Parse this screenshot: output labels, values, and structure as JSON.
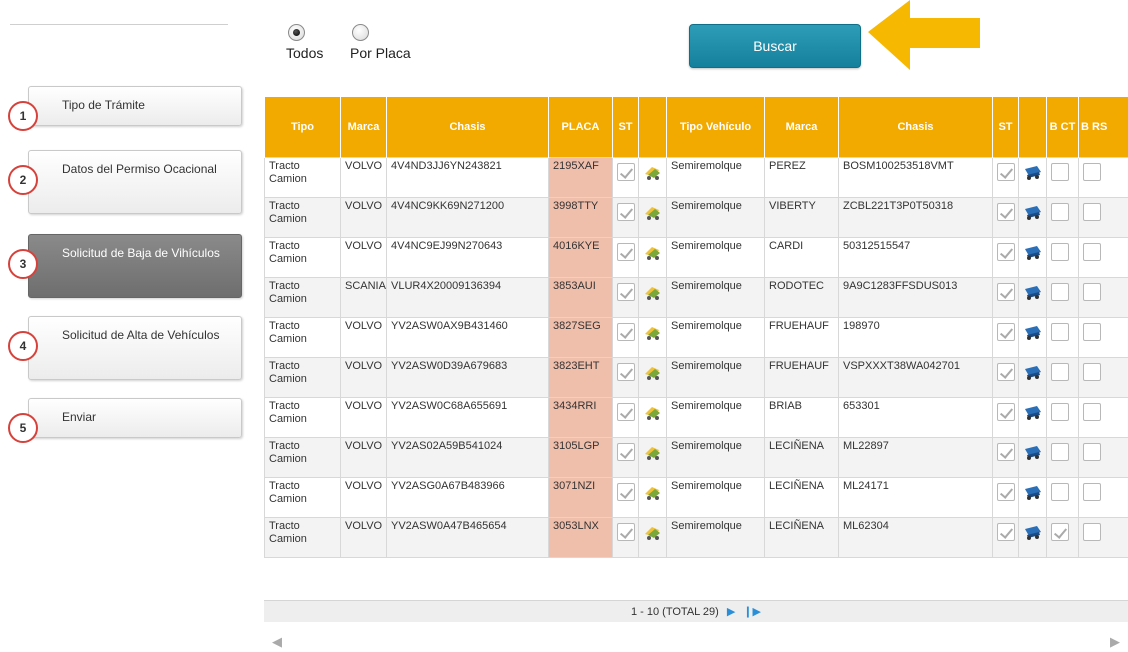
{
  "filter": {
    "options": [
      {
        "label": "Todos",
        "selected": true
      },
      {
        "label": "Por Placa",
        "selected": false
      }
    ]
  },
  "search_button": "Buscar",
  "steps": [
    {
      "num": "1",
      "label": "Tipo de Trámite"
    },
    {
      "num": "2",
      "label": "Datos del Permiso Ocacional"
    },
    {
      "num": "3",
      "label": "Solicitud de Baja de Vihículos",
      "active": true
    },
    {
      "num": "4",
      "label": "Solicitud de Alta de Vehículos"
    },
    {
      "num": "5",
      "label": "Enviar"
    }
  ],
  "table": {
    "headers": [
      "Tipo",
      "Marca",
      "Chasis",
      "PLACA",
      "ST",
      "",
      "Tipo Vehículo",
      "Marca",
      "Chasis",
      "ST",
      "",
      "B CT",
      "B RS"
    ],
    "rows": [
      {
        "tipo": "Tracto Camion",
        "marca": "VOLVO",
        "chasis": "4V4ND3JJ6YN243821",
        "placa": "2195XAF",
        "tipo2": "Semiremolque",
        "marca2": "PEREZ",
        "chasis2": "BOSM100253518VMT",
        "bct": false
      },
      {
        "tipo": "Tracto Camion",
        "marca": "VOLVO",
        "chasis": "4V4NC9KK69N271200",
        "placa": "3998TTY",
        "tipo2": "Semiremolque",
        "marca2": "VIBERTY",
        "chasis2": "ZCBL221T3P0T50318",
        "bct": false
      },
      {
        "tipo": "Tracto Camion",
        "marca": "VOLVO",
        "chasis": "4V4NC9EJ99N270643",
        "placa": "4016KYE",
        "tipo2": "Semiremolque",
        "marca2": "CARDI",
        "chasis2": "50312515547",
        "bct": false
      },
      {
        "tipo": "Tracto Camion",
        "marca": "SCANIA",
        "chasis": "VLUR4X20009136394",
        "placa": "3853AUI",
        "tipo2": "Semiremolque",
        "marca2": "RODOTEC",
        "chasis2": "9A9C1283FFSDUS013",
        "bct": false
      },
      {
        "tipo": "Tracto Camion",
        "marca": "VOLVO",
        "chasis": "YV2ASW0AX9B431460",
        "placa": "3827SEG",
        "tipo2": "Semiremolque",
        "marca2": "FRUEHAUF",
        "chasis2": "198970",
        "bct": false
      },
      {
        "tipo": "Tracto Camion",
        "marca": "VOLVO",
        "chasis": "YV2ASW0D39A679683",
        "placa": "3823EHT",
        "tipo2": "Semiremolque",
        "marca2": "FRUEHAUF",
        "chasis2": "VSPXXXT38WA042701",
        "bct": false
      },
      {
        "tipo": "Tracto Camion",
        "marca": "VOLVO",
        "chasis": "YV2ASW0C68A655691",
        "placa": "3434RRI",
        "tipo2": "Semiremolque",
        "marca2": "BRIAB",
        "chasis2": "653301",
        "bct": false
      },
      {
        "tipo": "Tracto Camion",
        "marca": "VOLVO",
        "chasis": "YV2AS02A59B541024",
        "placa": "3105LGP",
        "tipo2": "Semiremolque",
        "marca2": "LECIÑENA",
        "chasis2": "ML22897",
        "bct": false
      },
      {
        "tipo": "Tracto Camion",
        "marca": "VOLVO",
        "chasis": "YV2ASG0A67B483966",
        "placa": "3071NZI",
        "tipo2": "Semiremolque",
        "marca2": "LECIÑENA",
        "chasis2": "ML24171",
        "bct": false
      },
      {
        "tipo": "Tracto Camion",
        "marca": "VOLVO",
        "chasis": "YV2ASW0A47B465654",
        "placa": "3053LNX",
        "tipo2": "Semiremolque",
        "marca2": "LECIÑENA",
        "chasis2": "ML62304",
        "bct": true
      }
    ]
  },
  "pager": {
    "text": "1 - 10 (TOTAL 29)",
    "next_icon": "next-page-icon",
    "last_icon": "last-page-icon"
  },
  "icons": {
    "truck1": "truck-icon",
    "truck2": "trailer-icon"
  },
  "colors": {
    "header": "#f2a900",
    "placa": "#f0bfac",
    "button": "#16809c",
    "arrow": "#f6b800",
    "step_ring": "#d6423b"
  }
}
